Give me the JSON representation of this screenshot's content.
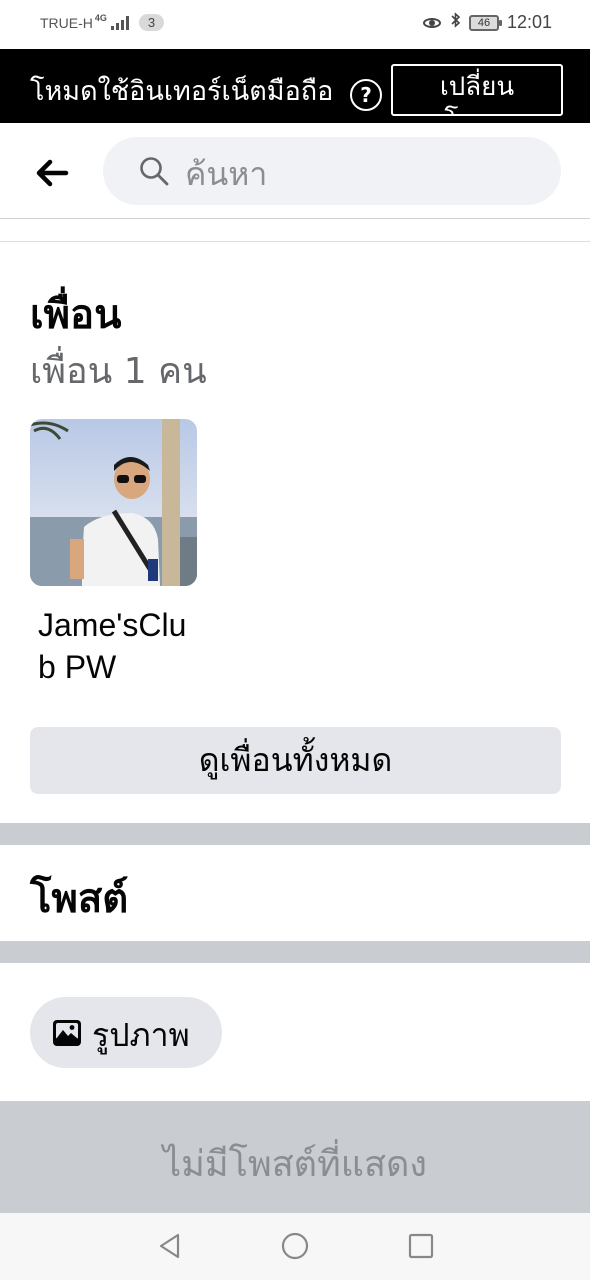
{
  "status_bar": {
    "carrier": "TRUE-H",
    "network": "4G",
    "notification_count": "3",
    "battery": "46",
    "time": "12:01"
  },
  "data_banner": {
    "text": "โหมดใช้อินเทอร์เน็ตมือถือ",
    "help": "?",
    "switch_label": "เปลี่ยน\nโหมด"
  },
  "search": {
    "placeholder": "ค้นหา"
  },
  "friends": {
    "title": "เพื่อน",
    "count_text": "เพื่อน 1 คน",
    "list": [
      {
        "name": "Jame'sClub PW"
      }
    ],
    "see_all_label": "ดูเพื่อนทั้งหมด"
  },
  "posts": {
    "title": "โพสต์",
    "photos_label": "รูปภาพ",
    "empty_text": "ไม่มีโพสต์ที่แสดง"
  },
  "colors": {
    "banner_bg": "#000000",
    "divider": "#c9ccd1",
    "button_bg": "#e4e6eb",
    "search_bg": "#f0f2f5",
    "secondary_text": "#65676b"
  }
}
